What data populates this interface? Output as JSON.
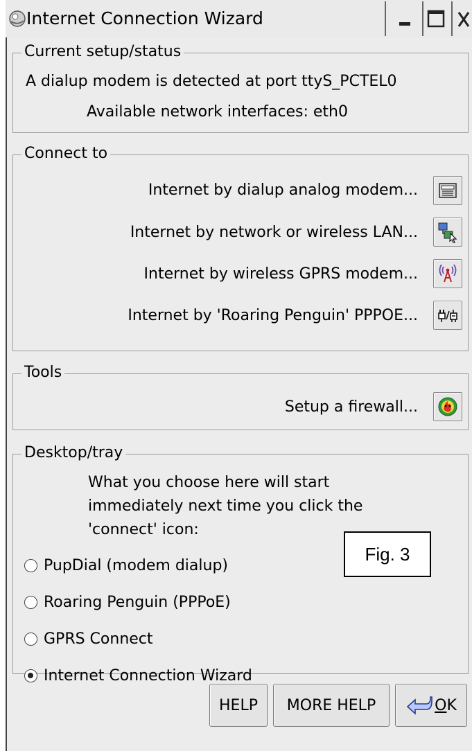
{
  "window": {
    "title": "Internet Connection Wizard"
  },
  "status": {
    "heading": "Current setup/status",
    "modem_line": "A dialup modem is detected at port ttyS_PCTEL0",
    "interfaces_line": "Available network interfaces: eth0"
  },
  "connect": {
    "heading": "Connect to",
    "items": [
      {
        "label": "Internet by dialup analog modem...",
        "icon": "modem-icon"
      },
      {
        "label": "Internet by network or wireless LAN...",
        "icon": "network-icon"
      },
      {
        "label": "Internet by wireless GPRS modem...",
        "icon": "antenna-icon"
      },
      {
        "label": "Internet by 'Roaring Penguin' PPPOE...",
        "icon": "plug-icon"
      }
    ]
  },
  "tools": {
    "heading": "Tools",
    "firewall_label": "Setup a firewall...",
    "firewall_icon": "firewall-icon"
  },
  "desktop": {
    "heading": "Desktop/tray",
    "description_lines": [
      "What you choose here will start",
      "immediately next time you click the",
      "'connect' icon:"
    ],
    "options": [
      {
        "label": "PupDial (modem dialup)",
        "checked": false
      },
      {
        "label": "Roaring Penguin (PPPoE)",
        "checked": false
      },
      {
        "label": "GPRS Connect",
        "checked": false
      },
      {
        "label": "Internet Connection Wizard",
        "checked": true
      }
    ]
  },
  "figure_label": "Fig. 3",
  "buttons": {
    "help": "HELP",
    "more_help": "MORE HELP",
    "ok_prefix": "O",
    "ok_rest": "K"
  }
}
